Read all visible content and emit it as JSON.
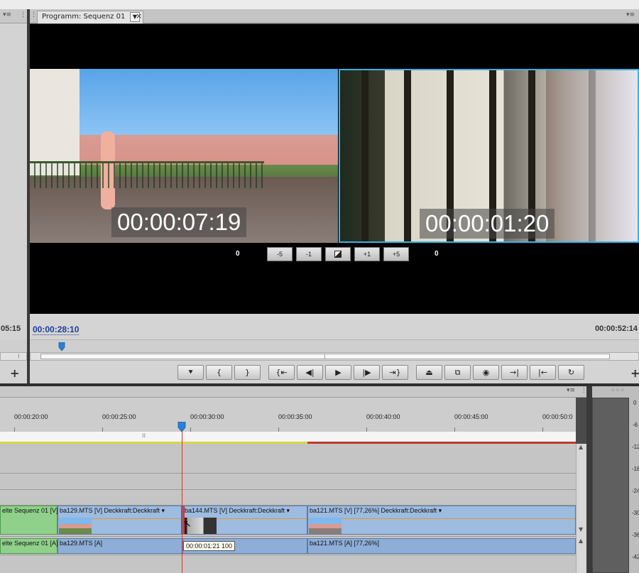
{
  "program_monitor": {
    "tab_label": "Programm: Sequenz 01",
    "left_clip_timecode": "00:00:07:19",
    "right_clip_timecode": "00:00:01:20",
    "trim_left_value": "0",
    "trim_right_value": "0",
    "trim_buttons": [
      "-5",
      "-1",
      "",
      "+1",
      "+5"
    ],
    "current_timecode": "00:00:28:10",
    "duration_timecode": "00:00:52:14",
    "left_panel_timecode": "05:15"
  },
  "timeline": {
    "ruler_labels": [
      "00:00:20:00",
      "00:00:25:00",
      "00:00:30:00",
      "00:00:35:00",
      "00:00:40:00",
      "00:00:45:00",
      "00:00:50:0"
    ],
    "video_clips": [
      {
        "title": "elte Sequenz 01 [V]",
        "color": "#8fd08a"
      },
      {
        "title": "ba129.MTS [V]  Deckkraft:Deckkraft ▾",
        "color": "#9ebbe0"
      },
      {
        "title": "ba144.MTS [V]  Deckkraft:Deckkraft ▾",
        "color": "#9ebbe0"
      },
      {
        "title": "ba121.MTS [V] [77,26%]  Deckkraft:Deckkraft ▾",
        "color": "#9ebbe0"
      }
    ],
    "audio_clips": [
      {
        "title": "elte Sequenz 01 [A]"
      },
      {
        "title": "ba129.MTS [A]"
      },
      {
        "title": ""
      },
      {
        "title": "ba121.MTS [A] [77,26%]"
      }
    ],
    "tooltip": "00:00:01:21  100"
  },
  "meter": {
    "labels": [
      "0",
      "-6",
      "-12",
      "-18",
      "-24",
      "-30",
      "-36",
      "-42"
    ]
  }
}
